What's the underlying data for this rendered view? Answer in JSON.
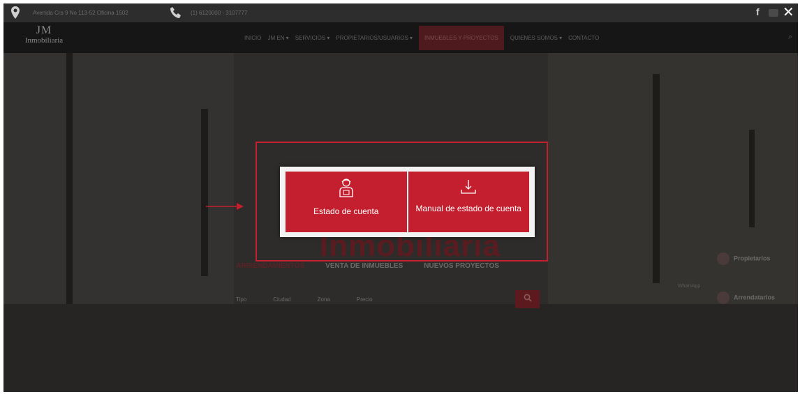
{
  "topbar": {
    "address": "Avenida Cra 9 No 113-52 Oficina 1502",
    "phone": "(1) 6120000 - 3107777",
    "facebook_glyph": "f",
    "close_glyph": "✕"
  },
  "nav": {
    "logo_jm": "JM",
    "logo_name": "Inmobiliaria",
    "menu": [
      "INICIO",
      "JM EN ▾",
      "SERVICIOS ▾",
      "PROPIETARIOS/USUARIOS ▾",
      "INMUEBLES Y PROYECTOS",
      "QUIENES SOMOS ▾",
      "CONTACTO"
    ],
    "search_glyph": "⌕"
  },
  "hero": {
    "title": "Inmobiliaria",
    "tabs": [
      "ARRIENDAMIENTOS",
      "VENTA DE INMUEBLES",
      "NUEVOS PROYECTOS"
    ],
    "search_fields": [
      "Tipo",
      "Ciudad",
      "Zona",
      "Precio"
    ],
    "side_links": [
      "Propietarios",
      "Arrendatarios"
    ],
    "whatsapp": "WhatsApp"
  },
  "modal": {
    "card_left": {
      "label": "Estado de cuenta",
      "icon": "user-icon"
    },
    "card_right": {
      "label": "Manual de estado de cuenta",
      "icon": "download-icon"
    }
  },
  "colors": {
    "accent": "#c41f2f",
    "modal_bg": "#f2f2f2",
    "overlay": "#2b2b2b"
  }
}
